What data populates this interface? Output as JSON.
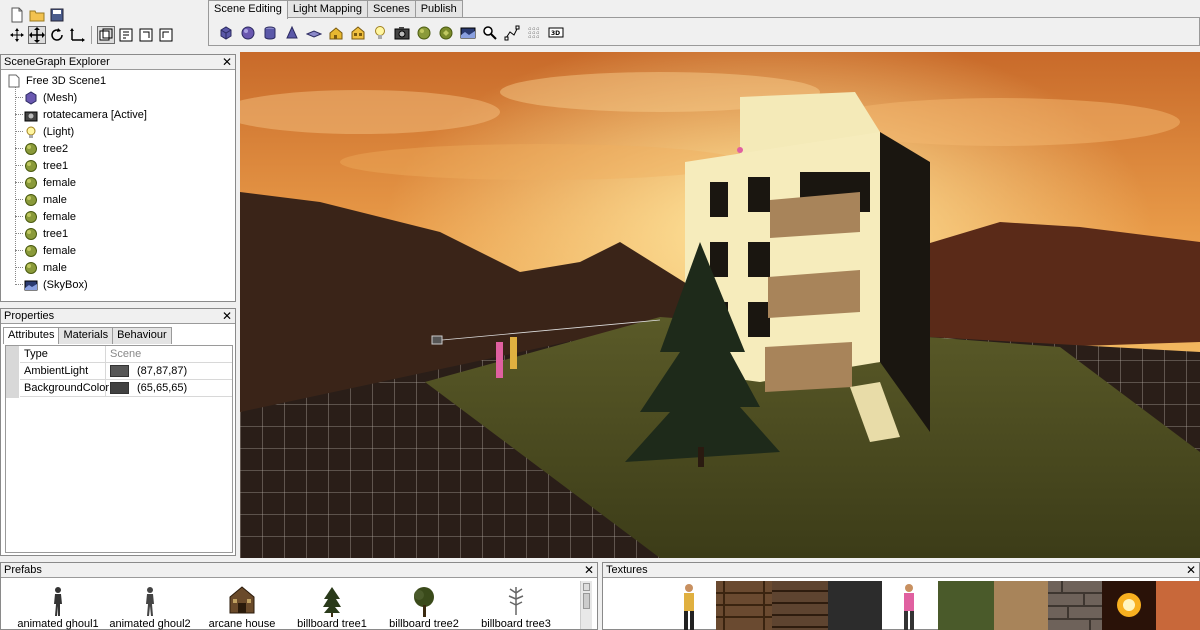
{
  "tabs": [
    {
      "label": "Scene Editing",
      "active": true
    },
    {
      "label": "Light Mapping",
      "active": false
    },
    {
      "label": "Scenes",
      "active": false
    },
    {
      "label": "Publish",
      "active": false
    }
  ],
  "toolbar_icons": [
    "new-file-icon",
    "open-folder-icon",
    "save-icon",
    "select-arrow-icon",
    "move-icon",
    "rotate-icon",
    "scale-icon",
    "view-1-icon",
    "view-2-icon",
    "view-3-icon",
    "view-4-icon"
  ],
  "tool_icons": [
    "cube-icon",
    "sphere-icon",
    "cylinder-icon",
    "cone-icon",
    "plane-icon",
    "house-icon",
    "building-icon",
    "light-bulb-icon",
    "camera-icon",
    "tree-icon",
    "tree-alt-icon",
    "skybox-icon",
    "magnifier-icon",
    "path-icon",
    "grid-icon",
    "billboard-icon"
  ],
  "scenegraph": {
    "title": "SceneGraph Explorer",
    "root": "Free 3D Scene1",
    "items": [
      {
        "label": "(Mesh)",
        "icon": "mesh-cube-icon"
      },
      {
        "label": "rotatecamera [Active]",
        "icon": "camera-icon"
      },
      {
        "label": "(Light)",
        "icon": "light-bulb-icon"
      },
      {
        "label": "tree2",
        "icon": "tree-node-icon"
      },
      {
        "label": "tree1",
        "icon": "tree-node-icon"
      },
      {
        "label": "female",
        "icon": "tree-node-icon"
      },
      {
        "label": "male",
        "icon": "tree-node-icon"
      },
      {
        "label": "female",
        "icon": "tree-node-icon"
      },
      {
        "label": "tree1",
        "icon": "tree-node-icon"
      },
      {
        "label": "female",
        "icon": "tree-node-icon"
      },
      {
        "label": "male",
        "icon": "tree-node-icon"
      },
      {
        "label": "(SkyBox)",
        "icon": "skybox-icon"
      }
    ]
  },
  "properties": {
    "title": "Properties",
    "tabs": [
      "Attributes",
      "Materials",
      "Behaviour"
    ],
    "header": {
      "key": "Type",
      "value": "Scene"
    },
    "rows": [
      {
        "key": "AmbientLight",
        "value": "(87,87,87)",
        "color": "#575757"
      },
      {
        "key": "BackgroundColor",
        "value": "(65,65,65)",
        "color": "#414141"
      }
    ]
  },
  "prefabs": {
    "title": "Prefabs",
    "items": [
      "animated ghoul1",
      "animated ghoul2",
      "arcane house",
      "billboard tree1",
      "billboard tree2",
      "billboard tree3"
    ]
  },
  "textures": {
    "title": "Textures"
  },
  "close_glyph": "✕"
}
